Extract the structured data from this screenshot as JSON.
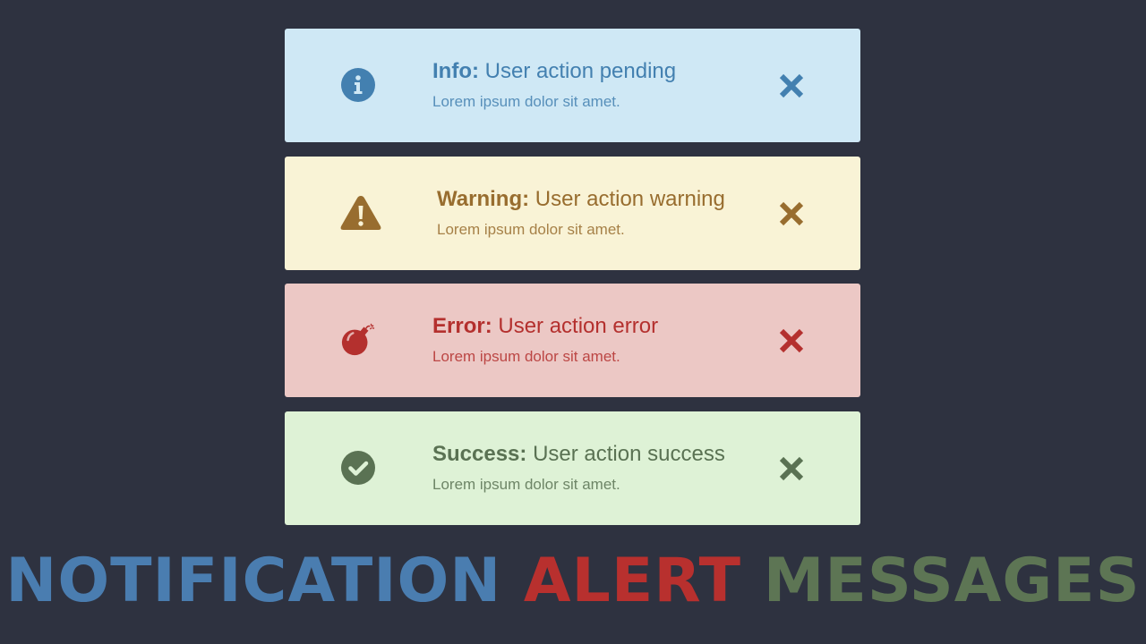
{
  "page": {
    "background": "#2e3240"
  },
  "alerts": [
    {
      "type": "info",
      "icon": "info-circle-icon",
      "label": "Info:",
      "title": "User action pending",
      "message": "Lorem ipsum dolor sit amet.",
      "bg": "#cfe8f5",
      "color": "#4380b0"
    },
    {
      "type": "warning",
      "icon": "warning-triangle-icon",
      "label": "Warning:",
      "title": "User action warning",
      "message": "Lorem ipsum dolor sit amet.",
      "bg": "#f9f3d6",
      "color": "#986d2f"
    },
    {
      "type": "error",
      "icon": "bomb-icon",
      "label": "Error:",
      "title": "User action error",
      "message": "Lorem ipsum dolor sit amet.",
      "bg": "#ecc8c5",
      "color": "#b4302e"
    },
    {
      "type": "success",
      "icon": "check-circle-icon",
      "label": "Success:",
      "title": "User action success",
      "message": "Lorem ipsum dolor sit amet.",
      "bg": "#def2d6",
      "color": "#5a7253"
    }
  ],
  "headline": {
    "word1": "NOTIFICATION",
    "word2": "ALERT",
    "word3": "MESSAGES",
    "color1": "#4a7db0",
    "color2": "#b8302e",
    "color3": "#5d7554"
  }
}
